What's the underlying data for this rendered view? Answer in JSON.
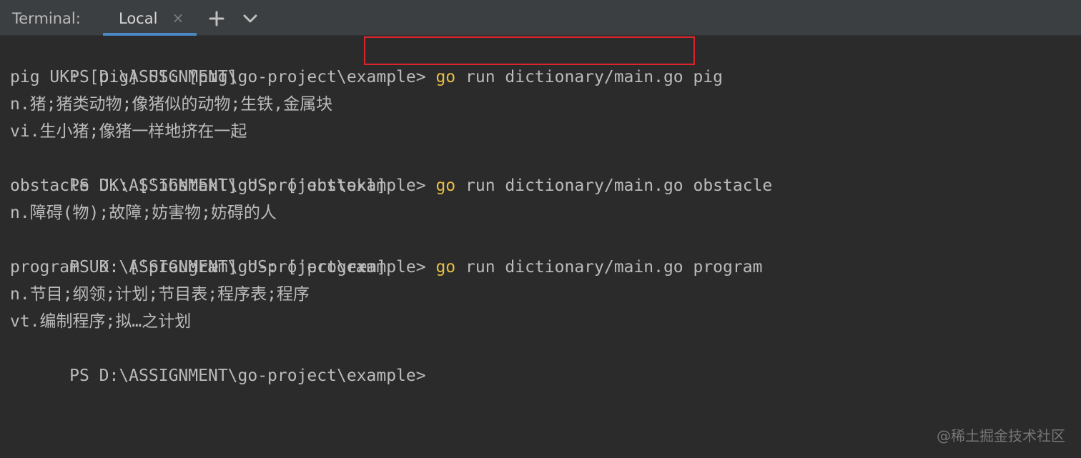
{
  "tool_window": {
    "title": "Terminal:",
    "tab_label": "Local",
    "tab_close_icon": "close-icon",
    "new_tab_icon": "plus-icon",
    "menu_icon": "chevron-down-icon"
  },
  "colors": {
    "background": "#2b2b2b",
    "tabbar": "#3c3f41",
    "text": "#bbbbbb",
    "command_keyword": "#e8bf45",
    "tab_underline": "#4a88c7",
    "highlight_box": "#d9262c"
  },
  "terminal": {
    "lines": [
      {
        "prompt": "PS D:\\ASSIGNMENT\\go-project\\example> ",
        "keyword": "go",
        "command_rest": " run dictionary/main.go pig"
      },
      {
        "text": "pig UK: [pig] US: [pɪg]"
      },
      {
        "text": "n.猪;猪类动物;像猪似的动物;生铁,金属块"
      },
      {
        "text": "vi.生小猪;像猪一样地挤在一起"
      },
      {
        "prompt": "PS D:\\ASSIGNMENT\\go-project\\example> ",
        "keyword": "go",
        "command_rest": " run dictionary/main.go obstacle"
      },
      {
        "text": "obstacle UK: [ˈɔbstəkl] US: [ˈɑbstəkl]"
      },
      {
        "text": "n.障碍(物);故障;妨害物;妨碍的人"
      },
      {
        "prompt": "PS D:\\ASSIGNMENT\\go-project\\example> ",
        "keyword": "go",
        "command_rest": " run dictionary/main.go program"
      },
      {
        "text": "program UK: [ˈprəugræm] US: [ˈprogræm]"
      },
      {
        "text": "n.节目;纲领;计划;节目表;程序表;程序"
      },
      {
        "text": "vt.编制程序;拟…之计划"
      },
      {
        "prompt": "PS D:\\ASSIGNMENT\\go-project\\example>"
      }
    ]
  },
  "watermark": "@稀土掘金技术社区"
}
